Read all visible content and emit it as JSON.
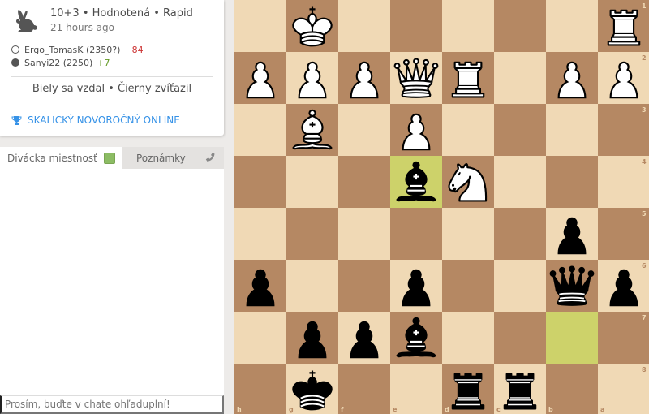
{
  "game": {
    "meta": "10+3 • Hodnotená • Rapid",
    "time_ago": "21 hours ago",
    "players": [
      {
        "color": "white",
        "name": "Ergo_TomasK (2350?)",
        "diff": "−84",
        "diff_sign": "neg"
      },
      {
        "color": "black",
        "name": "Sanyi22 (2250)",
        "diff": "+7",
        "diff_sign": "pos"
      }
    ],
    "result": "Biely sa vzdal • Čierny zvíťazil",
    "tournament": "SKALICKÝ NOVOROČNÝ ONLINE"
  },
  "chat": {
    "tab_room": "Divácka miestnosť",
    "tab_notes": "Poznámky",
    "placeholder": "Prosím, buďte v chate ohľaduplní!"
  },
  "board": {
    "orientation": "black",
    "files_display": [
      "h",
      "g",
      "f",
      "e",
      "d",
      "c",
      "b",
      "a"
    ],
    "ranks_display": [
      "1",
      "2",
      "3",
      "4",
      "5",
      "6",
      "7",
      "8"
    ],
    "highlights": [
      "e4",
      "b7"
    ],
    "colors": {
      "light": "#f0d9b5",
      "dark": "#b58863",
      "highlight": "#cdd26a"
    },
    "pieces": [
      {
        "square": "g1",
        "type": "king",
        "color": "white"
      },
      {
        "square": "a1",
        "type": "rook",
        "color": "white"
      },
      {
        "square": "h2",
        "type": "pawn",
        "color": "white"
      },
      {
        "square": "g2",
        "type": "pawn",
        "color": "white"
      },
      {
        "square": "f2",
        "type": "pawn",
        "color": "white"
      },
      {
        "square": "e2",
        "type": "queen",
        "color": "white"
      },
      {
        "square": "d2",
        "type": "rook",
        "color": "white"
      },
      {
        "square": "b2",
        "type": "pawn",
        "color": "white"
      },
      {
        "square": "a2",
        "type": "pawn",
        "color": "white"
      },
      {
        "square": "g3",
        "type": "bishop",
        "color": "white"
      },
      {
        "square": "e3",
        "type": "pawn",
        "color": "white"
      },
      {
        "square": "e4",
        "type": "bishop",
        "color": "black"
      },
      {
        "square": "d4",
        "type": "knight",
        "color": "white"
      },
      {
        "square": "b5",
        "type": "pawn",
        "color": "black"
      },
      {
        "square": "h6",
        "type": "pawn",
        "color": "black"
      },
      {
        "square": "e6",
        "type": "pawn",
        "color": "black"
      },
      {
        "square": "b6",
        "type": "queen",
        "color": "black"
      },
      {
        "square": "a6",
        "type": "pawn",
        "color": "black"
      },
      {
        "square": "g7",
        "type": "pawn",
        "color": "black"
      },
      {
        "square": "f7",
        "type": "pawn",
        "color": "black"
      },
      {
        "square": "e7",
        "type": "bishop",
        "color": "black"
      },
      {
        "square": "g8",
        "type": "king",
        "color": "black"
      },
      {
        "square": "d8",
        "type": "rook",
        "color": "black"
      },
      {
        "square": "c8",
        "type": "rook",
        "color": "black"
      }
    ]
  }
}
